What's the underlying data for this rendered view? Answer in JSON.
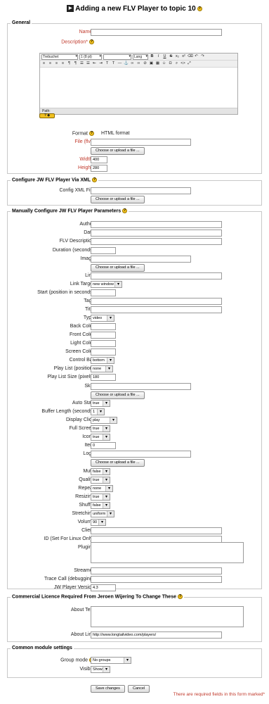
{
  "heading": {
    "icon": "flv-module-icon",
    "title": "Adding a new FLV Player to topic 10"
  },
  "general": {
    "legend": "General",
    "name_label": "Name*",
    "description_label": "Description*",
    "editor": {
      "font": "Trebuchet",
      "size": "1 (8 pt)",
      "style": "",
      "lang": "Lang",
      "path": "Path:"
    },
    "format_label": "Format",
    "format_value": "HTML format",
    "file_label": "File (flv)*",
    "choose_btn": "Choose or upload a file ...",
    "width_label": "Width*",
    "width_value": "400",
    "height_label": "Height*",
    "height_value": "280"
  },
  "xml": {
    "legend": "Configure JW FLV Player Via XML",
    "config_label": "Config XML File",
    "choose_btn": "Choose or upload a file ..."
  },
  "manual": {
    "legend": "Manually Configure JW FLV Player Parameters",
    "author": "Author",
    "date": "Date",
    "flv_description": "FLV Description",
    "duration": "Duration (seconds)",
    "image": "Image",
    "choose_btn": "Choose or upload a file ...",
    "link": "Link",
    "link_target": "Link Target",
    "link_target_value": "new window",
    "start": "Start (position in seconds)",
    "tags": "Tags",
    "title": "Title",
    "type": "Type",
    "type_value": "video",
    "back_color": "Back Color",
    "front_color": "Front Color",
    "light_color": "Light Color",
    "screen_color": "Screen Color",
    "control_bar": "Control Bar",
    "control_bar_value": "bottom",
    "play_list_position": "Play List (position)",
    "play_list_position_value": "none",
    "play_list_size": "Play List Size (pixels)",
    "play_list_size_value": "180",
    "skin": "Skin",
    "auto_start": "Auto Start",
    "auto_start_value": "true",
    "buffer_length": "Buffer Length (seconds)",
    "buffer_length_value": "1",
    "display_click": "Display Click",
    "display_click_value": "play",
    "full_screen": "Full Screen",
    "full_screen_value": "true",
    "icons": "Icons",
    "icons_value": "true",
    "item": "Item",
    "item_value": "0",
    "logo": "Logo",
    "mute": "Mute",
    "mute_value": "false",
    "quality": "Quality",
    "quality_value": "true",
    "repeat": "Repeat",
    "repeat_value": "none",
    "resizing": "Resizing",
    "resizing_value": "true",
    "shuffle": "Shuffle",
    "shuffle_value": "false",
    "stretching": "Stretching",
    "stretching_value": "uniform",
    "volume": "Volume",
    "volume_value": "90",
    "client": "Client",
    "id_linux": "ID (Set For Linux Only)",
    "plugins": "Plugins",
    "streamer": "Streamer",
    "trace_call": "Trace Call (debugging)",
    "jw_version": "JW Player Version",
    "jw_version_value": "4.3"
  },
  "licence": {
    "legend": "Commercial Licence Required From Jeroen Wijering To Change These",
    "about_text": "About Text",
    "about_link": "About Link",
    "about_link_value": "http://www.longtailvideo.com/players/"
  },
  "common": {
    "legend": "Common module settings",
    "group_mode": "Group mode",
    "group_mode_value": "No groups",
    "visible": "Visible",
    "visible_value": "Show"
  },
  "footer": {
    "save": "Save changes",
    "cancel": "Cancel",
    "required_note": "There are required fields in this form marked*"
  },
  "colors": {
    "required": "#c0392b",
    "border": "#c8c8c8",
    "help": "#f0c020"
  }
}
